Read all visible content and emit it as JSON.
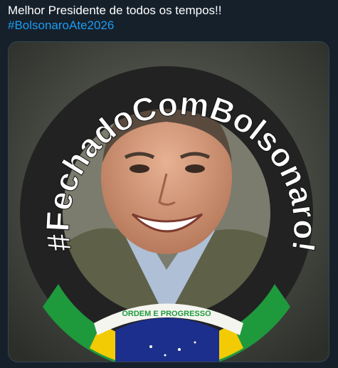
{
  "tweet": {
    "text": "Melhor Presidente de todos os tempos!!",
    "hashtag": "#BolsonaroAte2026"
  },
  "media": {
    "ring_text": "#FechadoComBolsonaro!",
    "banner_text": "ORDEM E PROGRESSO",
    "colors": {
      "background": "#15202b",
      "text": "#ffffff",
      "link": "#1d9bf0",
      "ring": "#222222",
      "flag_green": "#1e9a3d",
      "flag_yellow": "#f2cb05",
      "flag_blue": "#1c2f8c"
    }
  }
}
